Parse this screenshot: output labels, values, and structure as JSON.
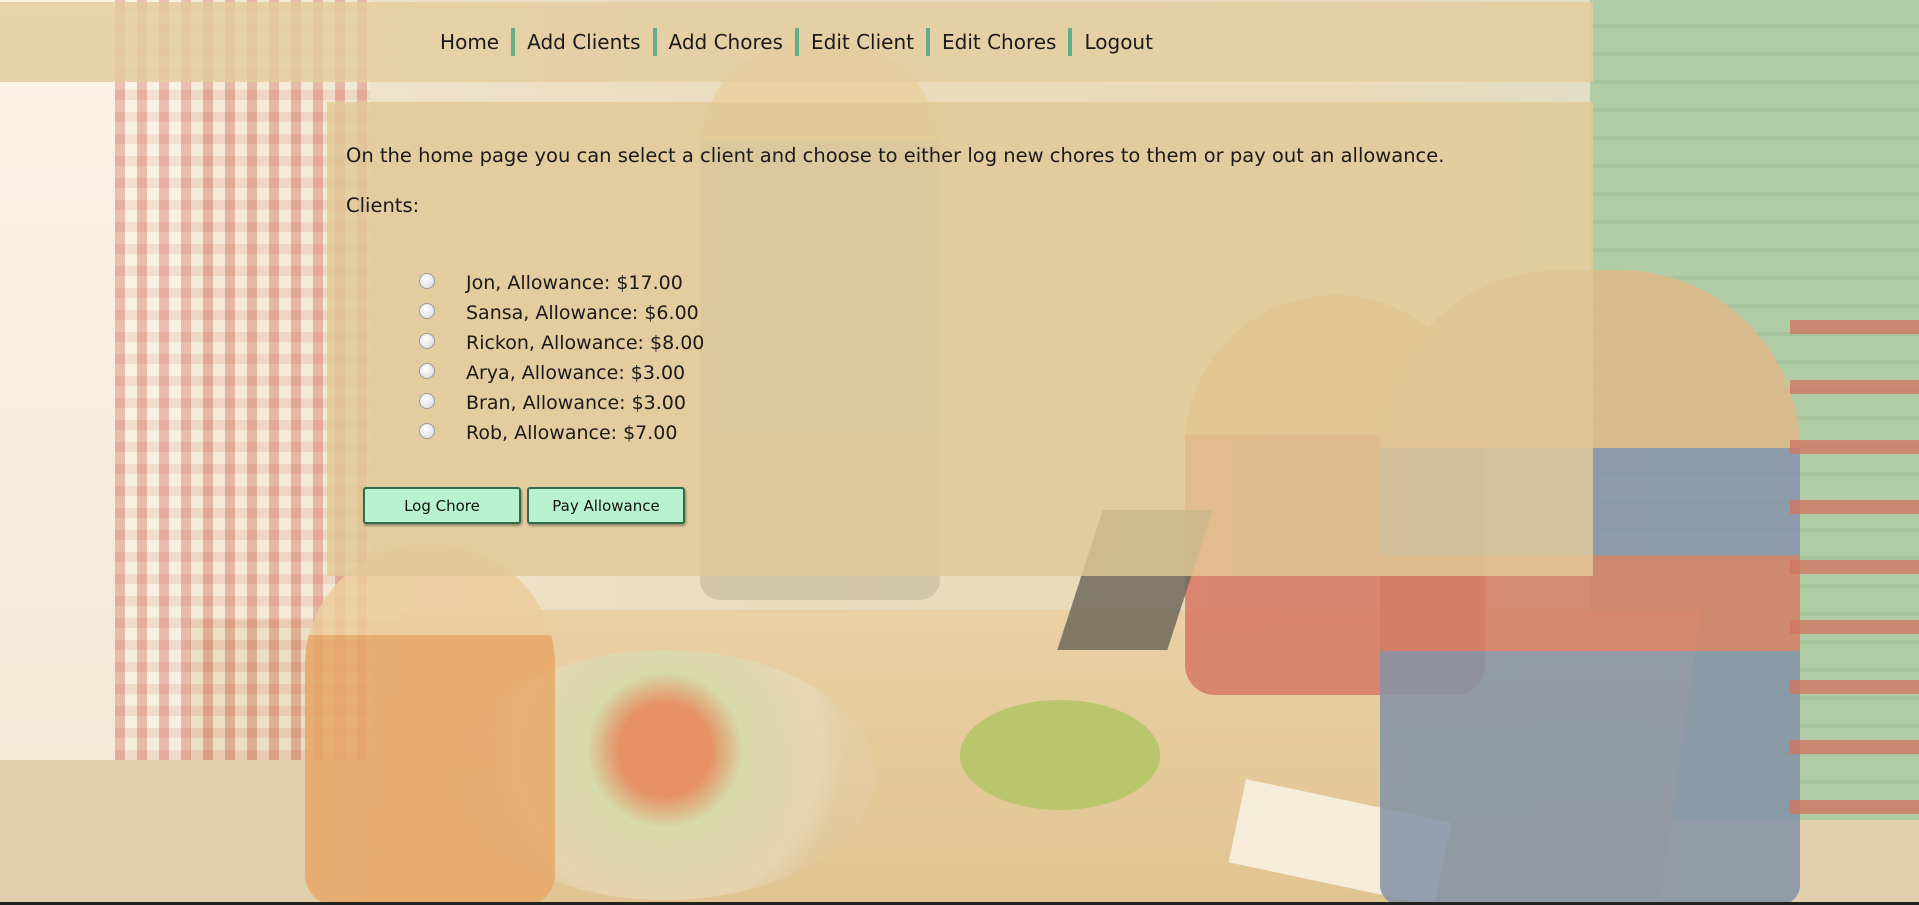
{
  "nav": {
    "items": [
      "Home",
      "Add Clients",
      "Add Chores",
      "Edit Client",
      "Edit Chores",
      "Logout"
    ]
  },
  "main": {
    "intro": "On the home page you can select a client and choose to either log new chores to them or pay out an allowance.",
    "clients_label": "Clients:",
    "clients": [
      "Jon, Allowance: $17.00",
      "Sansa, Allowance: $6.00",
      "Rickon, Allowance: $8.00",
      "Arya, Allowance: $3.00",
      "Bran, Allowance: $3.00",
      "Rob, Allowance: $7.00"
    ],
    "buttons": {
      "log_chore": "Log Chore",
      "pay_allowance": "Pay Allowance"
    }
  },
  "colors": {
    "nav_divider": "#5fae86",
    "button_bg": "#b8f2cf",
    "button_border": "#2f6b4c"
  }
}
